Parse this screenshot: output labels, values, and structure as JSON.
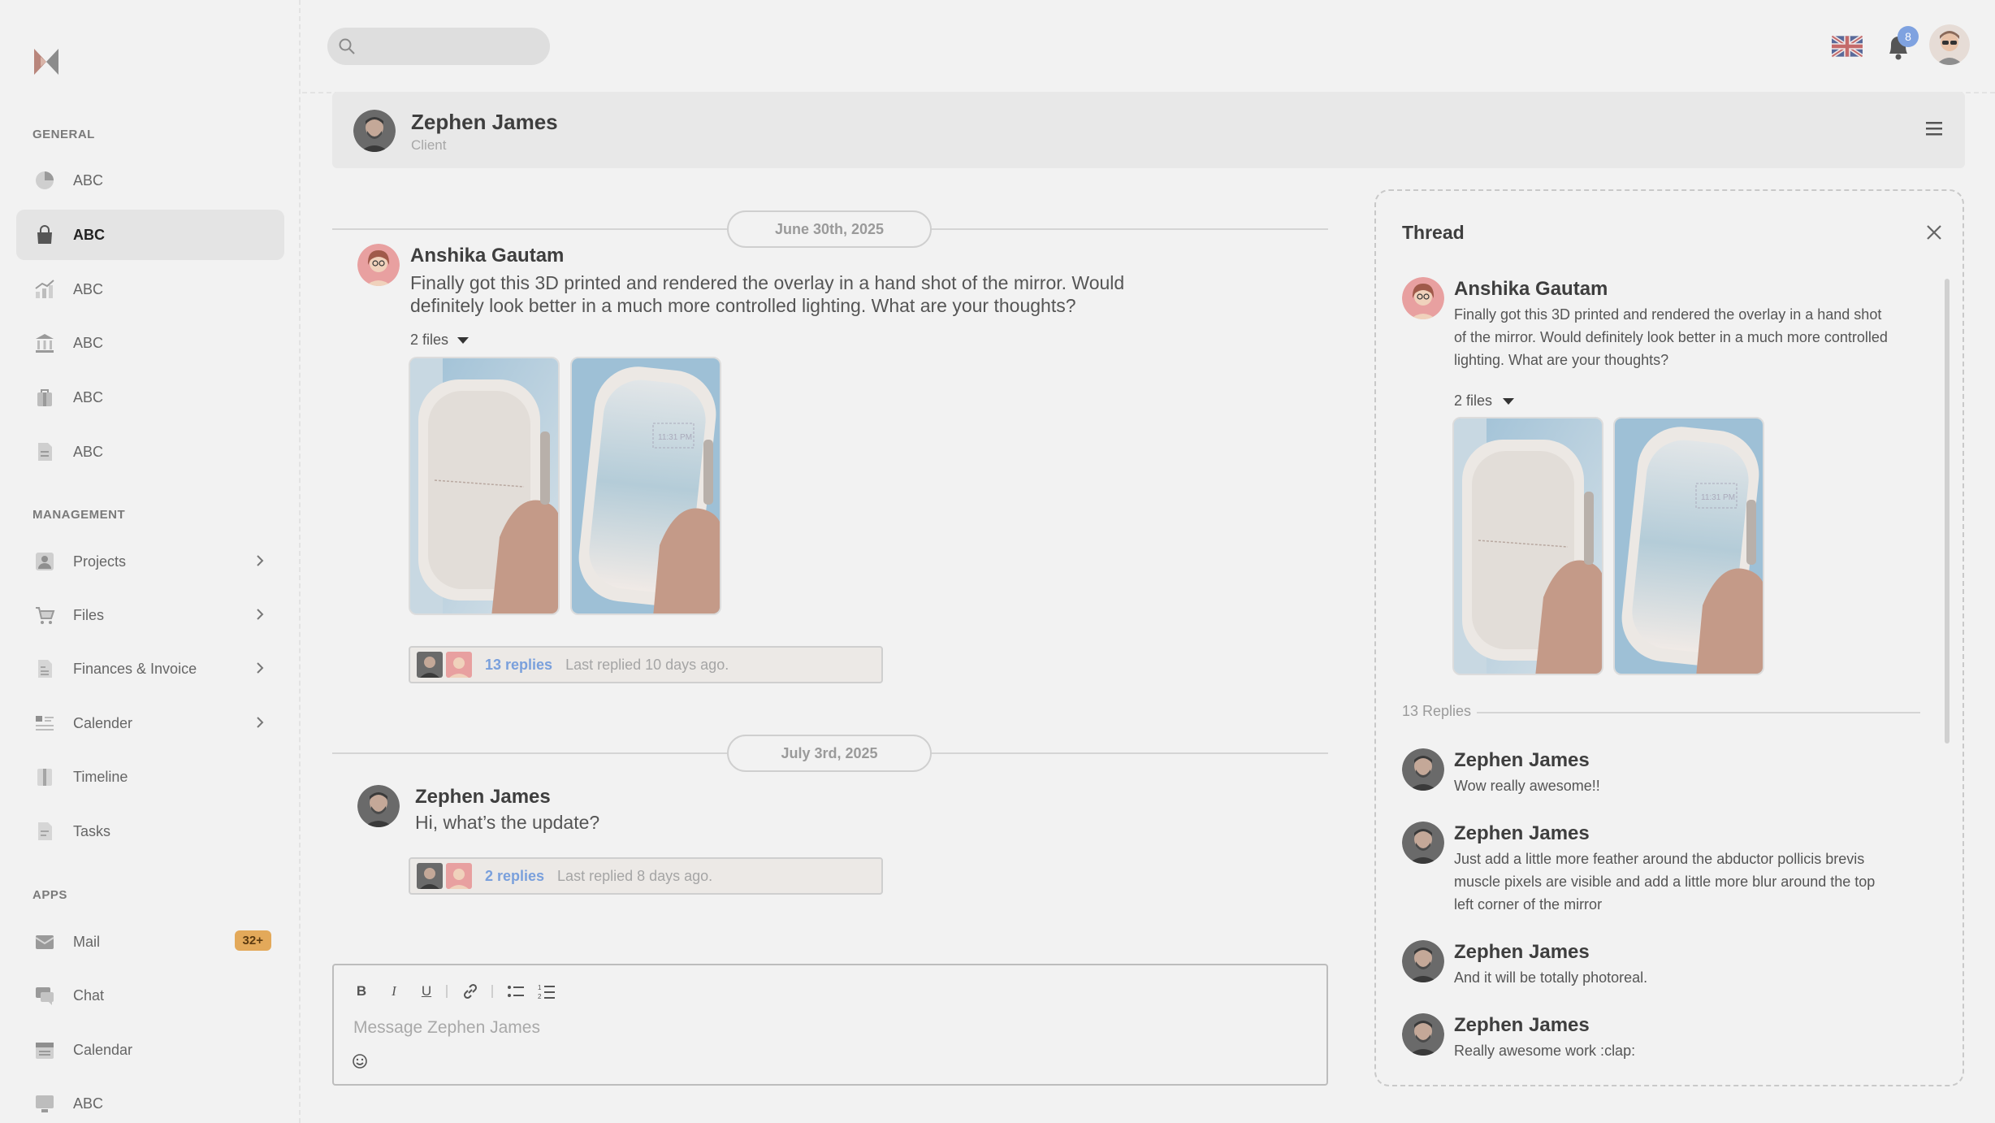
{
  "sidebar": {
    "sections": {
      "general": "GENERAL",
      "management": "MANAGEMENT",
      "apps": "APPS"
    },
    "general_items": [
      {
        "label": "ABC",
        "icon": "pie-chart-icon"
      },
      {
        "label": "ABC",
        "icon": "shopping-bag-icon",
        "active": true
      },
      {
        "label": "ABC",
        "icon": "analytics-icon"
      },
      {
        "label": "ABC",
        "icon": "bank-icon"
      },
      {
        "label": "ABC",
        "icon": "briefcase-icon"
      },
      {
        "label": "ABC",
        "icon": "document-icon"
      }
    ],
    "management_items": [
      {
        "label": "Projects",
        "icon": "user-card-icon"
      },
      {
        "label": "Files",
        "icon": "cart-icon"
      },
      {
        "label": "Finances & Invoice",
        "icon": "invoice-icon"
      },
      {
        "label": "Calender",
        "icon": "list-icon"
      },
      {
        "label": "Timeline",
        "icon": "book-icon"
      },
      {
        "label": "Tasks",
        "icon": "task-icon"
      }
    ],
    "apps_items": [
      {
        "label": "Mail",
        "icon": "mail-icon",
        "badge": "32+"
      },
      {
        "label": "Chat",
        "icon": "chat-icon"
      },
      {
        "label": "Calendar",
        "icon": "calendar-icon"
      },
      {
        "label": "ABC",
        "icon": "monitor-icon"
      }
    ]
  },
  "topbar": {
    "search_placeholder": "",
    "notification_count": "8"
  },
  "chat_header": {
    "name": "Zephen James",
    "subtitle": "Client"
  },
  "messages": {
    "date1": "June 30th, 2025",
    "date2": "July 3rd, 2025",
    "msg1": {
      "author": "Anshika Gautam",
      "text_line1": "Finally got this 3D printed and rendered the overlay in a hand shot of the mirror. Would",
      "text_line2": "definitely look better in a much more controlled lighting. What are your thoughts?",
      "files_label": "2 files",
      "replies": "13 replies",
      "last_replied": "Last replied 10 days ago."
    },
    "msg2": {
      "author": "Zephen James",
      "text": "Hi, what’s the update?",
      "replies": "2 replies",
      "last_replied": "Last replied 8 days ago."
    }
  },
  "composer": {
    "placeholder": "Message Zephen James",
    "tools": {
      "bold": "B",
      "italic": "I",
      "underline": "U"
    }
  },
  "thread": {
    "title": "Thread",
    "root": {
      "author": "Anshika Gautam",
      "text_line1": "Finally got this 3D printed and rendered the overlay in a hand shot",
      "text_line2": "of the mirror. Would definitely look better in a much more controlled",
      "text_line3": "lighting. What are your thoughts?",
      "files_label": "2 files"
    },
    "replies_count": "13 Replies",
    "replies": [
      {
        "author": "Zephen James",
        "line1": "Wow really awesome!!"
      },
      {
        "author": "Zephen James",
        "line1": "Just add a little more feather around the abductor pollicis brevis",
        "line2": "muscle pixels are visible and add a little more blur around the top",
        "line3": "left corner of the mirror"
      },
      {
        "author": "Zephen James",
        "line1": "And it will be totally photoreal."
      },
      {
        "author": "Zephen James",
        "line1": "Really awesome work :clap:"
      }
    ]
  },
  "colors": {
    "background": "#f2f2f2",
    "link": "#7aa0dc",
    "badge": "#e3a95a",
    "notification": "#7fa2e0"
  }
}
